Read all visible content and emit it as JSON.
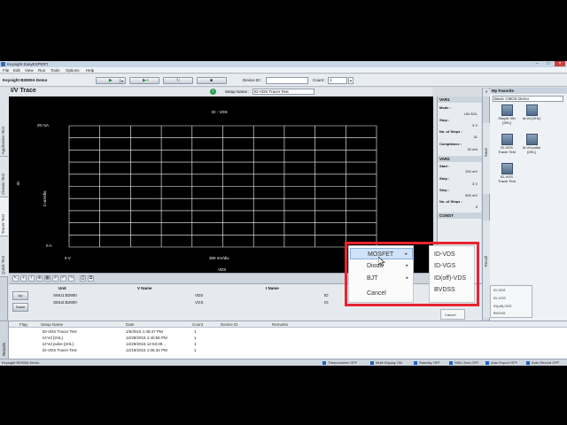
{
  "app": {
    "window_title": "Keysight EasyEXPERT",
    "menu": [
      "File",
      "Edit",
      "View",
      "Run",
      "Tools",
      "Options",
      "Help"
    ],
    "workspace_name": "Keysight B2900A Demo"
  },
  "toolbar": {
    "device_id_label": "Device ID :",
    "device_id_value": "",
    "count_label": "Count :",
    "count_value": "1"
  },
  "left_tabs": [
    "Application Test",
    "Classic Test",
    "Tracer Test",
    "Quick Test"
  ],
  "iv": {
    "title": "I/V Trace",
    "setup_name_label": "Setup Name :",
    "setup_name_value": "ID-VDS Tracer Test"
  },
  "graph": {
    "title": "ID - VDS",
    "y_max_label": "20 mA",
    "y_div_label": "2 mA/div.",
    "y_min_label": "0 A",
    "y_axis_name": "ID",
    "x_min_label": "0 V",
    "x_div_label": "300 mV/div.",
    "x_axis_name": "VDS"
  },
  "channels": {
    "headers": [
      "Unit",
      "V Name",
      "I Name"
    ],
    "rows": [
      {
        "unit": "SMU1:B2900",
        "v_name": "VDS",
        "i_name": "ID"
      },
      {
        "unit": "SMU2:B2900",
        "v_name": "VGS",
        "i_name": "IG"
      }
    ],
    "buttons": [
      "Up",
      "Down"
    ]
  },
  "var_panel": {
    "var1": {
      "title": "VAR1",
      "mode_label": "Mode :",
      "mode_value": "LIN SGL",
      "stop_label": "Stop :",
      "stop_value": "3 V",
      "steps_label": "No. of Steps :",
      "steps_value": "31",
      "compliance_label": "Compliance :",
      "compliance_value": "20 mA"
    },
    "var2": {
      "title": "VAR2",
      "start_label": "Start :",
      "start_value": "200 mV",
      "stop_label": "Stop :",
      "stop_value": "3 V",
      "step_label": "Step :",
      "step_value": "600 mV",
      "steps_label": "No. of Steps :",
      "steps_value": "5"
    },
    "const_title": "CONST"
  },
  "side_rail": [
    "Save",
    "Recall"
  ],
  "favorite": {
    "title": "My Favorite",
    "category": "Basic CMOS Demo",
    "items": [
      {
        "label": "Simple Vth [2HL]"
      },
      {
        "label": "Id-Vd [2HL]"
      },
      {
        "label": "ID-VDS Tracer Test"
      },
      {
        "label": "Id-Vd pulse [2HL]"
      },
      {
        "label": "ID-VGS Tracer Test"
      }
    ]
  },
  "faint_menu": [
    "ID-VDS",
    "ID-VGS",
    "ID(off)-VDS",
    "BVDSS"
  ],
  "faint_cancel": "Cancel",
  "context_menu": {
    "items": [
      {
        "label": "MOSFET",
        "has_sub": true
      },
      {
        "label": "Diode",
        "has_sub": true
      },
      {
        "label": "BJT",
        "has_sub": true
      },
      {
        "label": "Cancel",
        "has_sub": false
      }
    ],
    "submenu": [
      "ID-VDS",
      "ID-VGS",
      "ID(off)-VDS",
      "BVDSS"
    ]
  },
  "results": {
    "tab_label": "Results",
    "headers": [
      "Flag",
      "Setup Name",
      "Date",
      "Count",
      "Device ID",
      "Remarks"
    ],
    "rows": [
      {
        "setup": "ID-VDS Tracer Test",
        "date": "1/5/2016 1:48:47 PM",
        "count": "1"
      },
      {
        "setup": "Id-Vd [2HL]",
        "date": "12/29/2015 1:40:55 PM",
        "count": "1"
      },
      {
        "setup": "Id-Vd pulse [2HL]",
        "date": "12/29/2015 12:53:49...",
        "count": "1"
      },
      {
        "setup": "ID-VDS Tracer Test",
        "date": "12/19/2015 1:06:32 PM",
        "count": "1"
      }
    ]
  },
  "status_bar": {
    "left": "Keysight B2900A Demo",
    "items": [
      "Thermometer OFF",
      "Multi Display ON",
      "Standby OFF",
      "SMU Zero OFF",
      "Auto Export OFF",
      "Auto Record OFF"
    ]
  },
  "colors": {
    "highlight": "#e8232f",
    "menu_hover": "#cfe2f8",
    "graph_bg": "#000000",
    "grid": "#ffffff"
  }
}
